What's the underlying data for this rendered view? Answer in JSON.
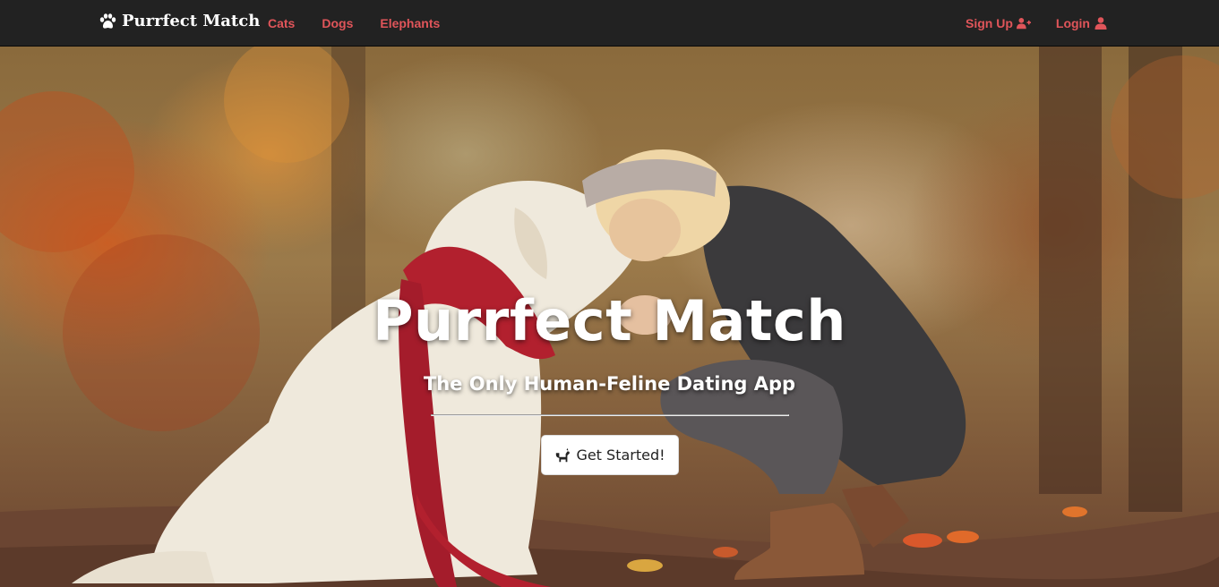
{
  "navbar": {
    "brand": {
      "icon": "paw-icon",
      "label": "Purrfect Match"
    },
    "left_links": [
      {
        "label": "Cats"
      },
      {
        "label": "Dogs"
      },
      {
        "label": "Elephants"
      }
    ],
    "right_links": [
      {
        "label": "Sign Up",
        "icon": "user-plus-icon"
      },
      {
        "label": "Login",
        "icon": "user-icon"
      }
    ],
    "background_color": "#222222",
    "link_color": "#e0555a"
  },
  "hero": {
    "title": "Purrfect Match",
    "subtitle": "The Only Human-Feline Dating App",
    "cta": {
      "label": "Get Started!",
      "icon": "dog-icon"
    },
    "background_image": "woman-hugging-white-dog-in-autumn-forest"
  }
}
